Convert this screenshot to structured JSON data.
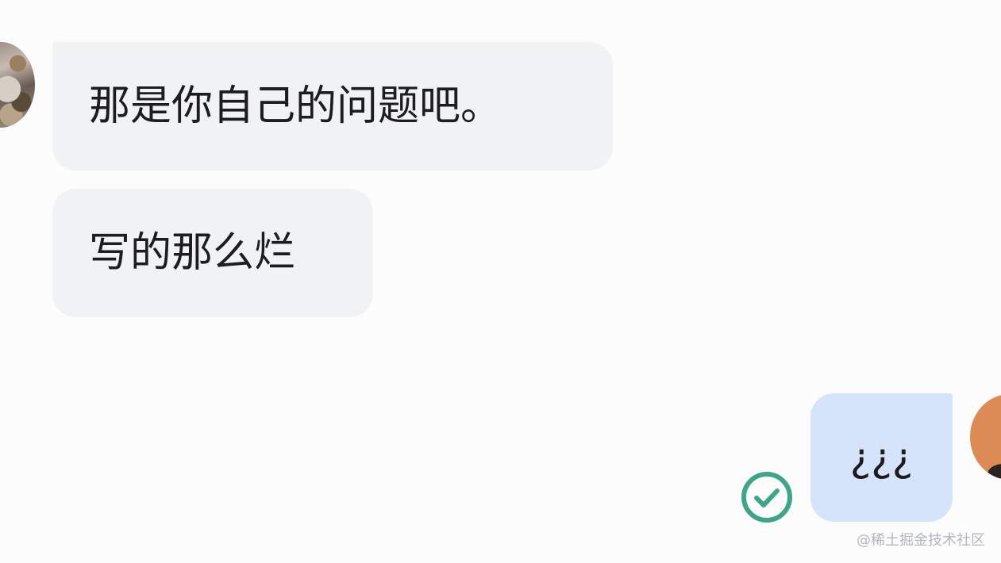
{
  "chat": {
    "messages": [
      {
        "direction": "incoming",
        "text": "那是你自己的问题吧。"
      },
      {
        "direction": "incoming",
        "text": "写的那么烂"
      },
      {
        "direction": "outgoing",
        "text": "¿¿¿",
        "status": "read"
      }
    ]
  },
  "watermark": "@稀土掘金技术社区",
  "icons": {
    "read_status": "check-circle-icon"
  },
  "colors": {
    "incoming_bubble": "#f1f2f4",
    "outgoing_bubble": "#d6e4fb",
    "read_check": "#3ea588",
    "text": "#1d1d1f"
  }
}
